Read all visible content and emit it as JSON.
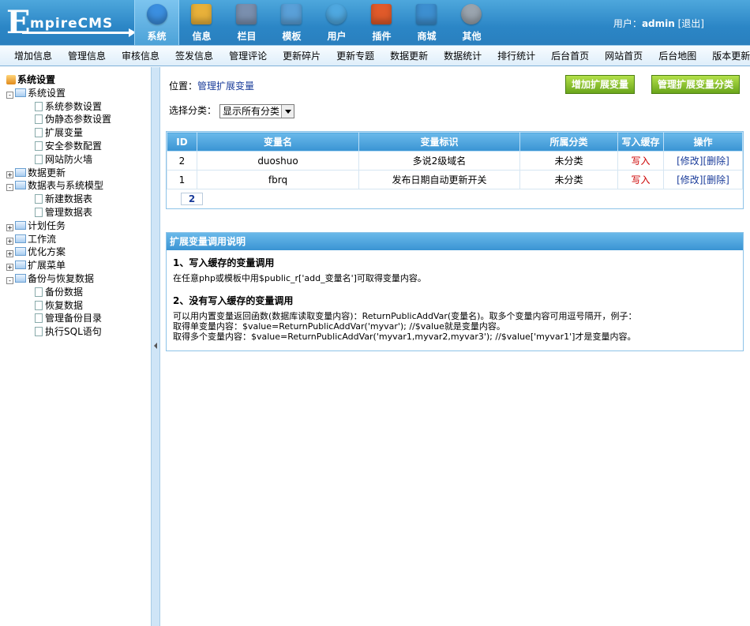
{
  "app": {
    "logo_big": "E",
    "logo_rest": "mpireCMS"
  },
  "topnav": [
    {
      "label": "系统",
      "icon": "globe-icon",
      "color": "#3b8fe0",
      "active": true
    },
    {
      "label": "信息",
      "icon": "notepad-icon",
      "color": "#e8b13a"
    },
    {
      "label": "栏目",
      "icon": "folder-icon",
      "color": "#7a8fae"
    },
    {
      "label": "模板",
      "icon": "window-icon",
      "color": "#5aa0d8"
    },
    {
      "label": "用户",
      "icon": "user-icon",
      "color": "#4fa8e0"
    },
    {
      "label": "插件",
      "icon": "tools-icon",
      "color": "#e05a2a"
    },
    {
      "label": "商城",
      "icon": "card-icon",
      "color": "#3d8fd0"
    },
    {
      "label": "其他",
      "icon": "gear-icon",
      "color": "#9aa4ae"
    }
  ],
  "user": {
    "prefix": "用户：",
    "name": "admin",
    "logout": "[退出]"
  },
  "menubar": [
    "增加信息",
    "管理信息",
    "审核信息",
    "签发信息",
    "管理评论",
    "更新碎片",
    "更新专题",
    "数据更新",
    "数据统计",
    "排行统计",
    "后台首页",
    "网站首页",
    "后台地图",
    "版本更新"
  ],
  "tree": [
    {
      "label": "系统设置",
      "type": "root"
    },
    {
      "label": "系统设置",
      "type": "folder",
      "toggle": "-"
    },
    {
      "label": "系统参数设置",
      "type": "doc"
    },
    {
      "label": "伪静态参数设置",
      "type": "doc"
    },
    {
      "label": "扩展变量",
      "type": "doc"
    },
    {
      "label": "安全参数配置",
      "type": "doc"
    },
    {
      "label": "网站防火墙",
      "type": "doc"
    },
    {
      "label": "数据更新",
      "type": "folder",
      "toggle": "+"
    },
    {
      "label": "数据表与系统模型",
      "type": "folder",
      "toggle": "-"
    },
    {
      "label": "新建数据表",
      "type": "doc"
    },
    {
      "label": "管理数据表",
      "type": "doc"
    },
    {
      "label": "计划任务",
      "type": "folder",
      "toggle": "+"
    },
    {
      "label": "工作流",
      "type": "folder",
      "toggle": "+"
    },
    {
      "label": "优化方案",
      "type": "folder",
      "toggle": "+"
    },
    {
      "label": "扩展菜单",
      "type": "folder",
      "toggle": "+"
    },
    {
      "label": "备份与恢复数据",
      "type": "folder",
      "toggle": "-"
    },
    {
      "label": "备份数据",
      "type": "doc"
    },
    {
      "label": "恢复数据",
      "type": "doc"
    },
    {
      "label": "管理备份目录",
      "type": "doc"
    },
    {
      "label": "执行SQL语句",
      "type": "doc"
    }
  ],
  "location": {
    "prefix": "位置：",
    "link": "管理扩展变量"
  },
  "buttons": {
    "add": "增加扩展变量",
    "manage_cat": "管理扩展变量分类"
  },
  "category": {
    "label": "选择分类：",
    "selected": "显示所有分类"
  },
  "table": {
    "headers": [
      "ID",
      "变量名",
      "变量标识",
      "所属分类",
      "写入缓存",
      "操作"
    ],
    "rows": [
      {
        "id": "2",
        "name": "duoshuo",
        "tag": "多说2级域名",
        "cat": "未分类",
        "cache": "写入",
        "edit": "[修改]",
        "del": "[删除]"
      },
      {
        "id": "1",
        "name": "fbrq",
        "tag": "发布日期自动更新开关",
        "cat": "未分类",
        "cache": "写入",
        "edit": "[修改]",
        "del": "[删除]"
      }
    ],
    "page": "2"
  },
  "help": {
    "title": "扩展变量调用说明",
    "h1": "1、写入缓存的变量调用",
    "p1": "在任意php或模板中用$public_r['add_变量名']可取得变量内容。",
    "h2": "2、没有写入缓存的变量调用",
    "p2a": "可以用内置变量返回函数(数据库读取变量内容)：ReturnPublicAddVar(变量名)。取多个变量内容可用逗号隔开，例子：",
    "p2b": "取得单变量内容：$value=ReturnPublicAddVar('myvar'); //$value就是变量内容。",
    "p2c": "取得多个变量内容：$value=ReturnPublicAddVar('myvar1,myvar2,myvar3'); //$value['myvar1']才是变量内容。"
  }
}
